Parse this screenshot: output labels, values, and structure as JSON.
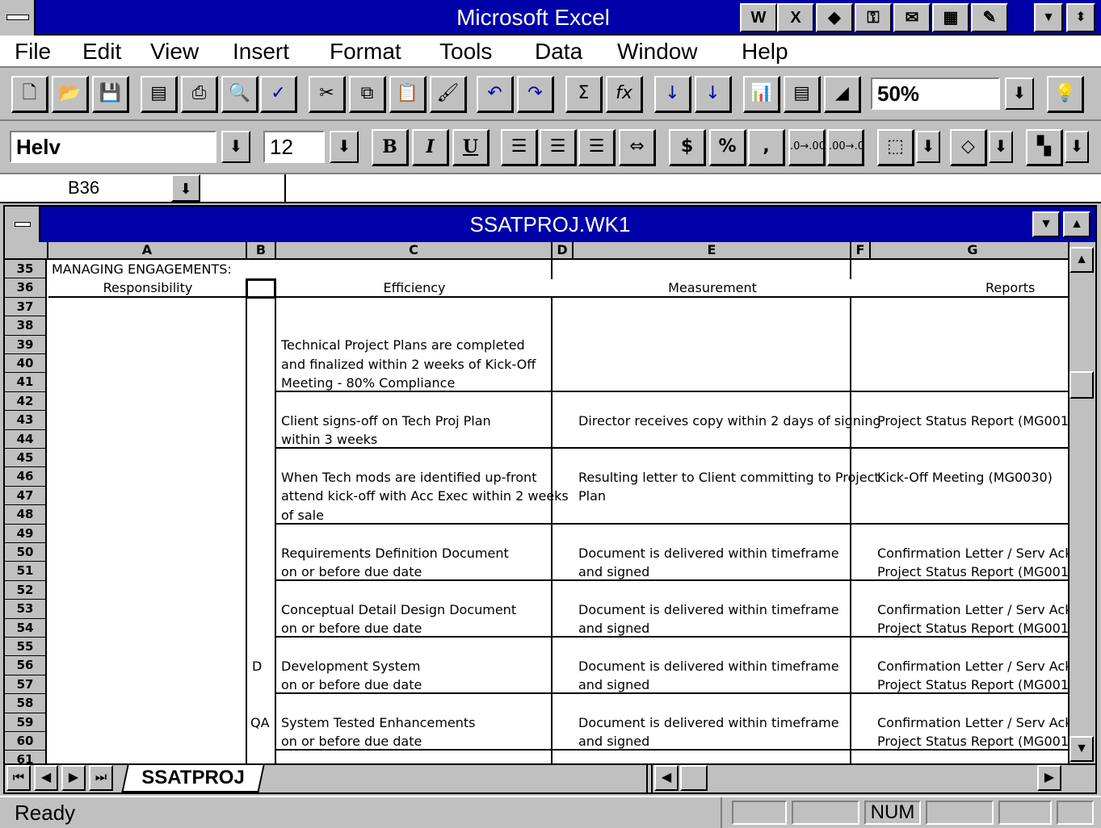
{
  "app": {
    "title": "Microsoft Excel"
  },
  "menu": [
    "File",
    "Edit",
    "View",
    "Insert",
    "Format",
    "Tools",
    "Data",
    "Window",
    "Help"
  ],
  "formatting": {
    "font_name": "Helv",
    "font_size": "12",
    "zoom": "50%"
  },
  "formula_bar": {
    "cell_ref": "B36",
    "content": ""
  },
  "workbook": {
    "title": "SSATPROJ.WK1",
    "sheet_tab": "SSATPROJ",
    "columns": [
      "A",
      "B",
      "C",
      "D",
      "E",
      "F",
      "G"
    ],
    "rows": [
      "35",
      "36",
      "37",
      "38",
      "39",
      "40",
      "41",
      "42",
      "43",
      "44",
      "45",
      "46",
      "47",
      "48",
      "49",
      "50",
      "51",
      "52",
      "53",
      "54",
      "55",
      "56",
      "57",
      "58",
      "59",
      "60",
      "61"
    ],
    "heading": "MANAGING ENGAGEMENTS:",
    "col_headers_text": {
      "a": "Responsibility",
      "c": "Efficiency",
      "e": "Measurement",
      "g": "Reports"
    },
    "cells": {
      "c39": "Technical Project Plans are completed",
      "c40": "and finalized within 2 weeks of Kick-Off",
      "c41": "Meeting - 80% Compliance",
      "c43": "Client signs-off on Tech Proj Plan",
      "c44": "within 3 weeks",
      "e43": "Director receives copy within 2 days of signing",
      "g43": "Project Status Report (MG001",
      "c46": "When Tech mods are identified up-front",
      "c47": "attend kick-off with Acc Exec within 2 weeks",
      "c48": "of sale",
      "e46": "Resulting letter to Client committing to Project",
      "e47": "Plan",
      "g46": "Kick-Off Meeting (MG0030)",
      "c50": "Requirements Definition Document",
      "c51": "on or before due date",
      "e50": "Document is delivered within timeframe",
      "e51": "and signed",
      "g50": "Confirmation Letter / Serv Ack",
      "g51": "Project Status Report (MG001",
      "c53": "Conceptual Detail Design Document",
      "c54": "on or before due date",
      "e53": "Document is delivered within timeframe",
      "e54": "and signed",
      "g53": "Confirmation Letter / Serv Ack",
      "g54": "Project Status Report (MG001",
      "b56": "D",
      "c56": "Development System",
      "c57": "on or before due date",
      "e56": "Document is delivered within timeframe",
      "e57": "and signed",
      "g56": "Confirmation Letter / Serv Ack",
      "g57": "Project Status Report (MG001",
      "b59": "QA",
      "c59": "System Tested Enhancements",
      "c60": "on or before due date",
      "e59": "Document is delivered within timeframe",
      "e60": "and signed",
      "g59": "Confirmation Letter / Serv Ack",
      "g60": "Project Status Report (MG001"
    }
  },
  "status": {
    "text": "Ready",
    "num": "NUM"
  },
  "icons": {
    "sum": "Σ",
    "function": "fx",
    "bold": "B",
    "italic": "I",
    "underline": "U",
    "currency": "$",
    "percent": "%",
    "comma": ","
  }
}
